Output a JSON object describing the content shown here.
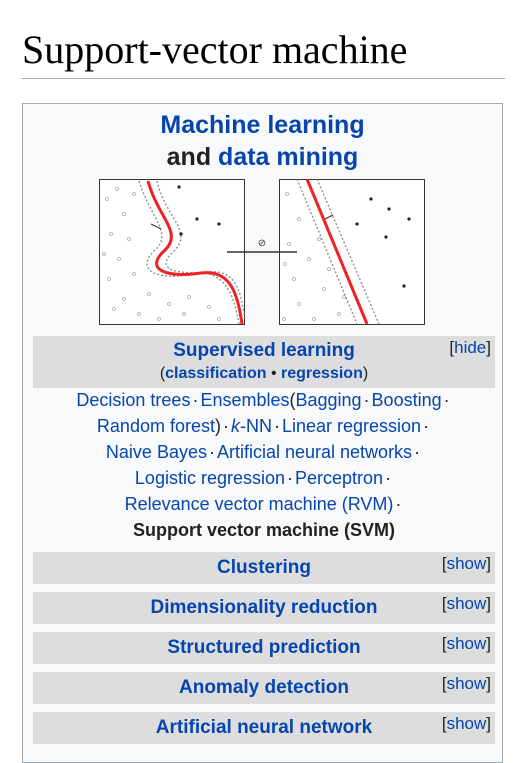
{
  "page": {
    "title": "Support-vector machine"
  },
  "sidebar": {
    "title_line1": "Machine learning",
    "title_and": "and",
    "title_line2": "data mining",
    "image_symbol": "⊘",
    "supervised": {
      "title": "Supervised learning",
      "toggle_open": "[",
      "toggle_label": "hide",
      "toggle_close": "]",
      "sub_open": "(",
      "sub_classification": "classification",
      "sub_bullet": "•",
      "sub_regression": "regression",
      "sub_close": ")",
      "items": {
        "decision_trees": "Decision trees",
        "ensembles": "Ensembles",
        "bagging": "Bagging",
        "boosting": "Boosting",
        "random_forest": "Random forest",
        "knn_k": "k",
        "knn_rest": "-NN",
        "linear_regression": "Linear regression",
        "naive_bayes": "Naive Bayes",
        "ann": "Artificial neural networks",
        "logistic_regression": "Logistic regression",
        "perceptron": "Perceptron",
        "rvm": "Relevance vector machine (RVM)",
        "svm": "Support vector machine (SVM)"
      },
      "sep": "·",
      "paren_open": "(",
      "paren_close": ")"
    },
    "groups": [
      {
        "title": "Clustering",
        "toggle": "show"
      },
      {
        "title": "Dimensionality reduction",
        "toggle": "show"
      },
      {
        "title": "Structured prediction",
        "toggle": "show"
      },
      {
        "title": "Anomaly detection",
        "toggle": "show"
      },
      {
        "title": "Artificial neural network",
        "toggle": "show"
      }
    ]
  },
  "colors": {
    "link": "#0645ad",
    "header_bg": "#dddddd",
    "panel_bg": "#f8f9fa",
    "border": "#a2a9b1"
  }
}
